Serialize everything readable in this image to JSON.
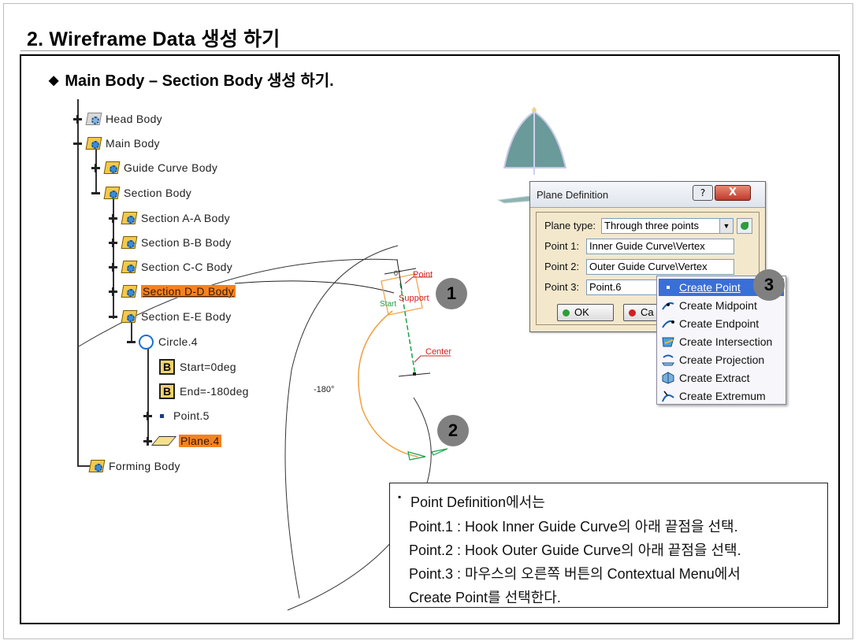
{
  "page": {
    "title": "2. Wireframe Data 생성 하기",
    "subtitle": "Main Body – Section Body 생성 하기.",
    "subtitle_bullet": "◆"
  },
  "tree": {
    "items": [
      {
        "label": "Head Body"
      },
      {
        "label": "Main Body"
      },
      {
        "label": "Guide Curve Body"
      },
      {
        "label": "Section Body"
      },
      {
        "label": "Section A-A Body"
      },
      {
        "label": "Section B-B Body"
      },
      {
        "label": "Section C-C Body"
      },
      {
        "label": "Section D-D Body"
      },
      {
        "label": "Section E-E Body"
      },
      {
        "label": "Circle.4"
      },
      {
        "label": "Start=0deg"
      },
      {
        "label": "End=-180deg"
      },
      {
        "label": "Point.5"
      },
      {
        "label": "Plane.4"
      },
      {
        "label": "Forming Body"
      }
    ],
    "b_glyph": "B"
  },
  "viewport": {
    "angle_label": "-180°",
    "point_label": "Point",
    "support_label": "Support",
    "start_label": "Start",
    "center_label": "Center",
    "small_angle": "0°"
  },
  "callouts": [
    "1",
    "2",
    "3"
  ],
  "dialog": {
    "title": "Plane Definition",
    "help_glyph": "?",
    "close_glyph": "X",
    "plane_type_label": "Plane type:",
    "plane_type_value": "Through three points",
    "point1_label": "Point 1:",
    "point1_value": "Inner Guide Curve\\Vertex",
    "point2_label": "Point 2:",
    "point2_value": "Outer Guide Curve\\Vertex",
    "point3_label": "Point 3:",
    "point3_value": "Point.6",
    "ok_label": "OK",
    "cancel_label": "Ca"
  },
  "context_menu": {
    "items": [
      {
        "label": "Create Point",
        "icon": "point-icon",
        "selected": true
      },
      {
        "label": "Create Midpoint",
        "icon": "midpoint-icon"
      },
      {
        "label": "Create Endpoint",
        "icon": "endpoint-icon"
      },
      {
        "label": "Create Intersection",
        "icon": "intersection-icon"
      },
      {
        "label": "Create Projection",
        "icon": "projection-icon"
      },
      {
        "label": "Create Extract",
        "icon": "extract-icon"
      },
      {
        "label": "Create Extremum",
        "icon": "extremum-icon"
      }
    ]
  },
  "note": {
    "bullet": "▪",
    "lines": [
      "Point Definition에서는",
      "Point.1 : Hook Inner Guide Curve의 아래 끝점을 선택.",
      "Point.2 : Hook Outer Guide Curve의 아래 끝점을 선택.",
      "Point.3 : 마우스의 오른쪽 버튼의 Contextual Menu에서",
      "Create Point를 선택한다."
    ]
  },
  "colors": {
    "highlight": "#f58220",
    "callout": "#808080",
    "menu_selected": "#3a6fd8",
    "dialog_bg": "#f3e8cc",
    "shape_fill": "#6a9a9a"
  }
}
